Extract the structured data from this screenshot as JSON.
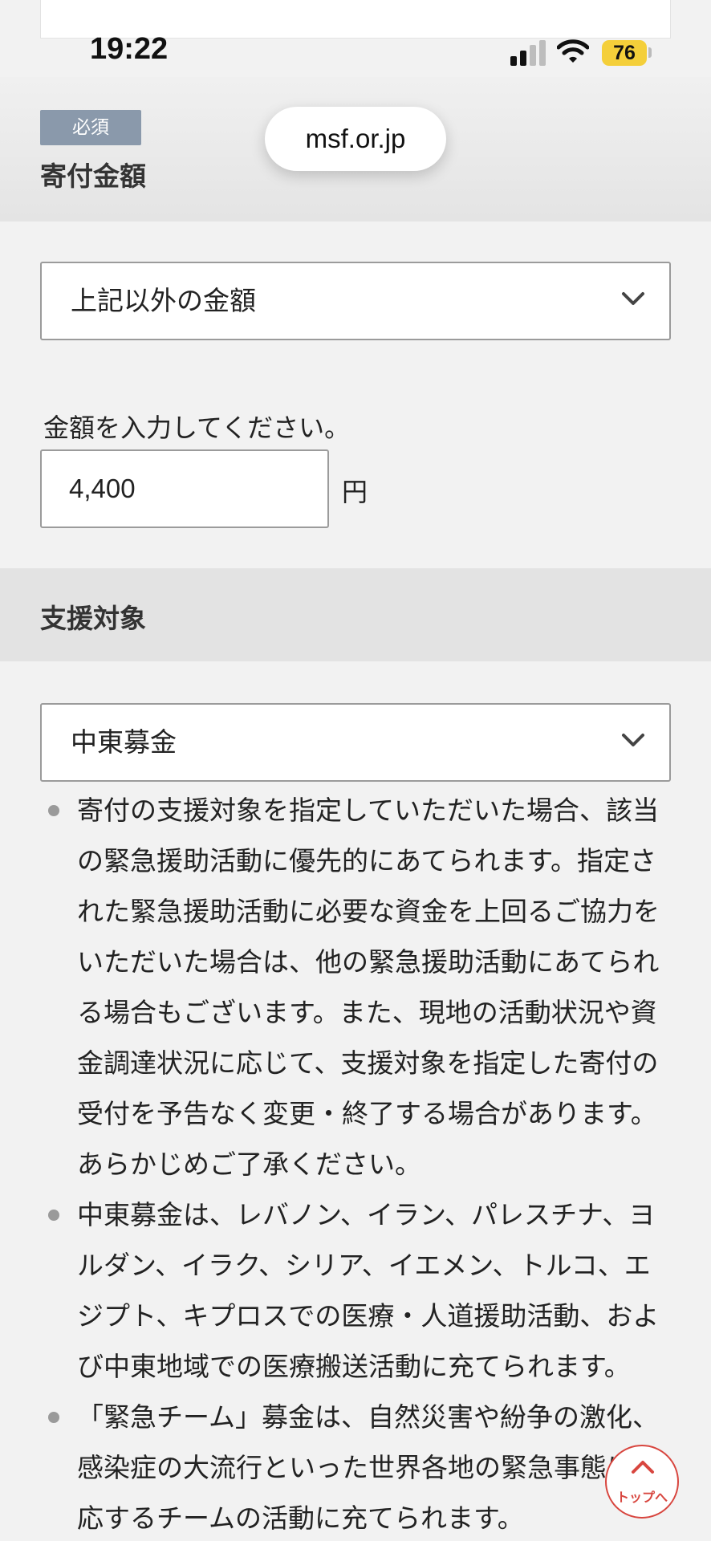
{
  "status": {
    "time": "19:22",
    "battery": "76"
  },
  "browser": {
    "url": "msf.or.jp"
  },
  "donation_amount": {
    "required_badge": "必須",
    "title": "寄付金額",
    "select_value": "上記以外の金額",
    "input_label": "金額を入力してください。",
    "input_value": "4,400",
    "unit": "円"
  },
  "support_target": {
    "title": "支援対象",
    "select_value": "中東募金",
    "notes": [
      "寄付の支援対象を指定していただいた場合、該当の緊急援助活動に優先的にあてられます。指定された緊急援助活動に必要な資金を上回るご協力をいただいた場合は、他の緊急援助活動にあてられる場合もございます。また、現地の活動状況や資金調達状況に応じて、支援対象を指定した寄付の受付を予告なく変更・終了する場合があります。あらかじめご了承ください。",
      "中東募金は、レバノン、イラン、パレスチナ、ヨルダン、イラク、シリア、イエメン、トルコ、エジプト、キプロスでの医療・人道援助活動、および中東地域での医療搬送活動に充てられます。",
      "「緊急チーム」募金は、自然災害や紛争の激化、感染症の大流行といった世界各地の緊急事態に即応するチームの活動に充てられます。"
    ]
  },
  "back_to_top": {
    "label": "トップへ"
  },
  "colors": {
    "accent": "#d8463f",
    "badge": "#8a99ab",
    "battery": "#f4cf3a"
  }
}
